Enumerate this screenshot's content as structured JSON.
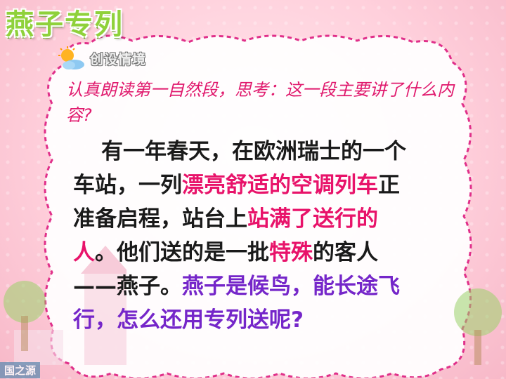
{
  "title": "燕子专列",
  "section": {
    "label": "创设情境",
    "icon": "sun-cloud-icon"
  },
  "question": "认真朗读第一自然段，思考：这一段主要讲了什么内容?",
  "passage": {
    "segments": [
      {
        "text": "有一年春天，在欧洲瑞士的一个车站，一列",
        "style": "normal"
      },
      {
        "text": "漂亮舒适的空调列车",
        "style": "pink"
      },
      {
        "text": "正准备启程，站台上",
        "style": "normal"
      },
      {
        "text": "站满了送行的人",
        "style": "pink"
      },
      {
        "text": "。他们送的是一批",
        "style": "normal"
      },
      {
        "text": "特殊",
        "style": "pink"
      },
      {
        "text": "的客人——燕子。",
        "style": "normal"
      },
      {
        "text": "燕子是候鸟，能长途飞行，怎么还用专列送呢?",
        "style": "purple"
      }
    ]
  },
  "watermark": "国之源",
  "colors": {
    "title": "#8fd13b",
    "question": "#e0196d",
    "highlight": "#e8136a",
    "emphasis": "#7526c9",
    "panel": "#ffffff",
    "border": "#e0308a"
  }
}
